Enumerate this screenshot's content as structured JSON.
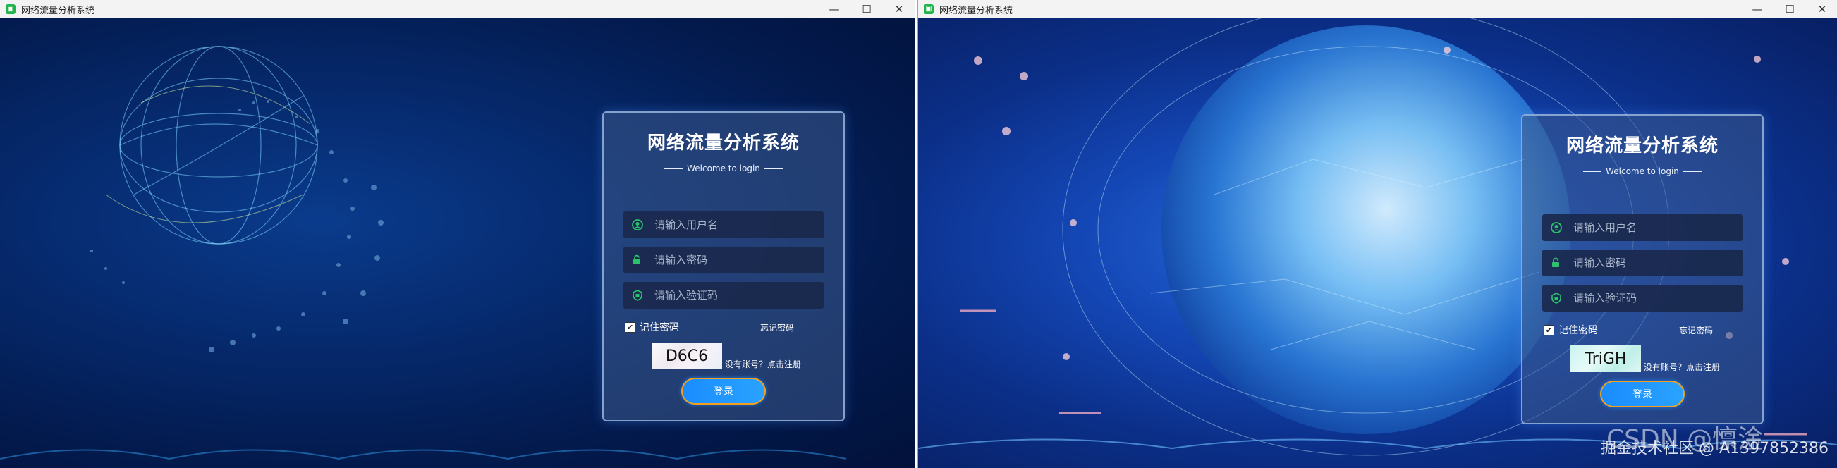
{
  "windows": [
    {
      "title": "网络流量分析系统",
      "login": {
        "title": "网络流量分析系统",
        "subtitle": "Welcome to login",
        "username_placeholder": "请输入用户名",
        "password_placeholder": "请输入密码",
        "code_placeholder": "请输入验证码",
        "remember_label": "记住密码",
        "forgot_label": "忘记密码",
        "captcha_text": "D6C6",
        "register_label": "没有账号？点击注册",
        "login_button": "登录"
      }
    },
    {
      "title": "网络流量分析系统",
      "login": {
        "title": "网络流量分析系统",
        "subtitle": "Welcome to login",
        "username_placeholder": "请输入用户名",
        "password_placeholder": "请输入密码",
        "code_placeholder": "请输入验证码",
        "remember_label": "记住密码",
        "forgot_label": "忘记密码",
        "captcha_text": "TriGH",
        "register_label": "没有账号？点击注册",
        "login_button": "登录"
      }
    }
  ],
  "watermark": {
    "csdn": "CSDN @懔淦",
    "text": "掘金技术社区 @ A1397852386"
  },
  "colors": {
    "icon_green": "#2ac36b",
    "button_blue": "#1a8cff",
    "button_border": "#f4a01e"
  },
  "icons": [
    "user-icon",
    "lock-icon",
    "shield-icon",
    "minimize-icon",
    "maximize-icon",
    "close-icon"
  ]
}
